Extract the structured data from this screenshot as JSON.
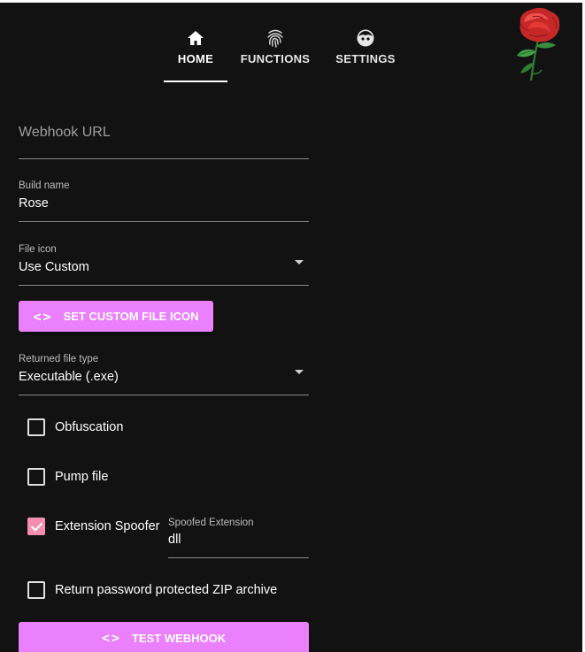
{
  "nav": {
    "tabs": [
      {
        "label": "HOME",
        "icon": "home-icon",
        "active": true
      },
      {
        "label": "FUNCTIONS",
        "icon": "fingerprint-icon",
        "active": false
      },
      {
        "label": "SETTINGS",
        "icon": "face-icon",
        "active": false
      }
    ]
  },
  "logo": {
    "icon": "rose-icon"
  },
  "form": {
    "webhook_url": {
      "placeholder": "Webhook URL",
      "value": ""
    },
    "build_name": {
      "label": "Build name",
      "value": "Rose"
    },
    "file_icon": {
      "label": "File icon",
      "value": "Use Custom"
    },
    "set_icon_button": {
      "label": "SET CUSTOM FILE ICON",
      "icon": "code-icon"
    },
    "file_type": {
      "label": "Returned file type",
      "value": "Executable (.exe)"
    },
    "obfuscation": {
      "label": "Obfuscation",
      "checked": false
    },
    "pump_file": {
      "label": "Pump file",
      "checked": false
    },
    "extension_spoofer": {
      "label": "Extension Spoofer",
      "checked": true
    },
    "spoofed_extension": {
      "label": "Spoofed Extension",
      "value": "dll"
    },
    "zip_archive": {
      "label": "Return password protected ZIP archive",
      "checked": false
    },
    "test_button": {
      "label": "TEST WEBHOOK",
      "icon": "code-icon"
    }
  },
  "colors": {
    "background": "#121212",
    "accent": "#ea80fc",
    "checkbox_checked": "#f48fb1"
  }
}
